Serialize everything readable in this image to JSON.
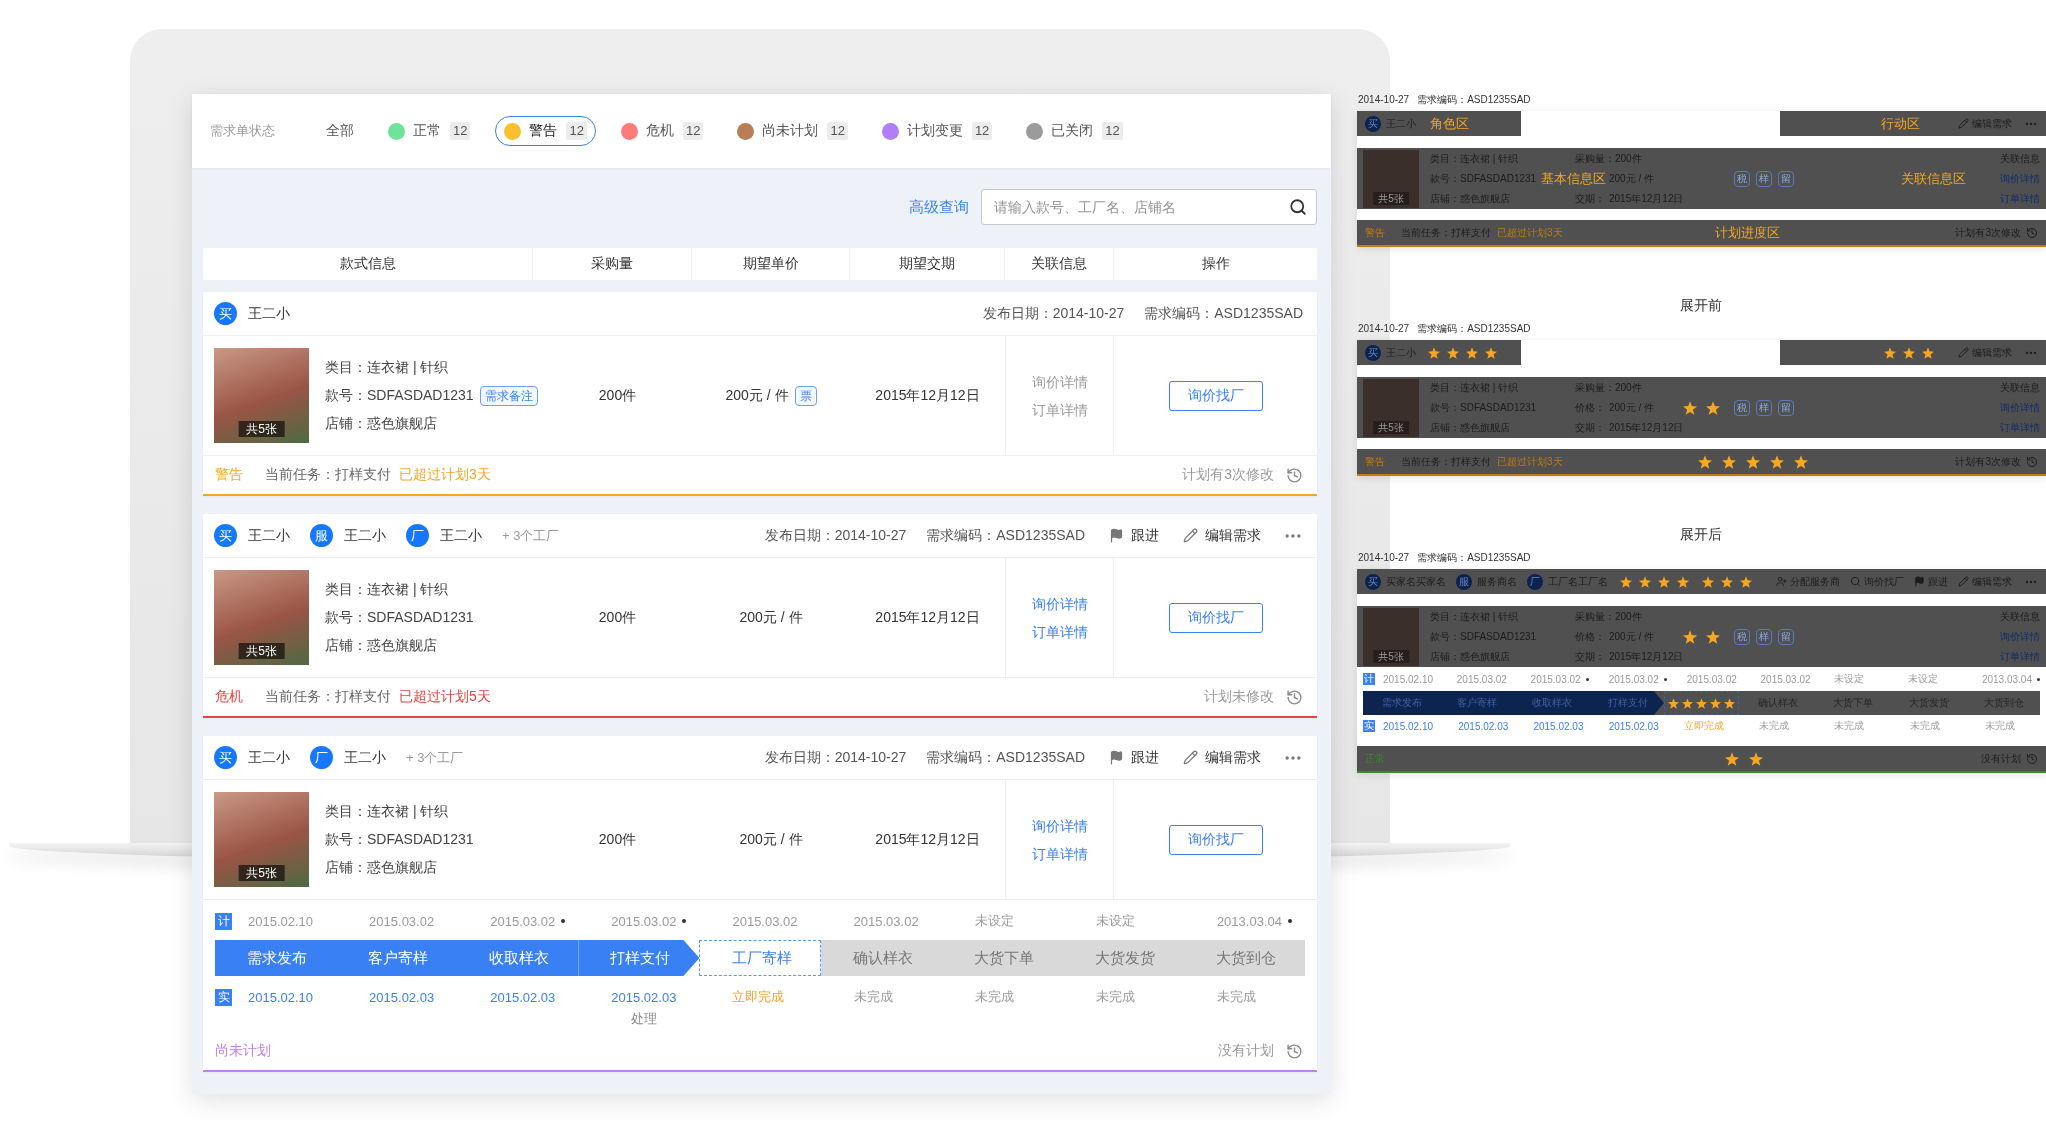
{
  "status_filter": {
    "label": "需求单状态",
    "items": [
      {
        "label": "全部",
        "selected": false
      },
      {
        "label": "正常",
        "count": "12",
        "color": "#6fe29c",
        "selected": false
      },
      {
        "label": "警告",
        "count": "12",
        "color": "#fbc02d",
        "selected": true
      },
      {
        "label": "危机",
        "count": "12",
        "color": "#ff7b7b",
        "selected": false
      },
      {
        "label": "尚未计划",
        "count": "12",
        "color": "#b97e57",
        "selected": false
      },
      {
        "label": "计划变更",
        "count": "12",
        "color": "#b07ef8",
        "selected": false
      },
      {
        "label": "已关闭",
        "count": "12",
        "color": "#9b9b9b",
        "selected": false
      }
    ]
  },
  "search": {
    "advanced_link": "高级查询",
    "placeholder": "请输入款号、工厂名、店铺名"
  },
  "table": {
    "columns": [
      "款式信息",
      "采购量",
      "期望单价",
      "期望交期",
      "关联信息",
      "操作"
    ]
  },
  "orders": [
    {
      "roles": [
        {
          "badge": "买",
          "name": "王二小"
        }
      ],
      "publish_date": "发布日期：2014-10-27",
      "code": "需求编码：ASD1235SAD",
      "photo_count": "共5张",
      "category": "类目：连衣裙 | 针织",
      "style_no": "款号：SDFASDAD1231",
      "note_tag": "需求备注",
      "shop": "店铺：惑色旗舰店",
      "quantity": "200件",
      "price": "200元 / 件",
      "invoice_tag": "票",
      "delivery": "2015年12月12日",
      "links": [
        {
          "label": "询价详情",
          "disabled": true
        },
        {
          "label": "订单详情",
          "disabled": true
        }
      ],
      "button": "询价找厂",
      "status": {
        "label": "警告",
        "color": "#f5a623"
      },
      "task": "当前任务：打样支付",
      "overdue": "已超过计划3天",
      "plan_note": "计划有3次修改"
    },
    {
      "roles": [
        {
          "badge": "买",
          "name": "王二小"
        },
        {
          "badge": "服",
          "name": "王二小"
        },
        {
          "badge": "厂",
          "name": "王二小"
        }
      ],
      "more_factories": "+ 3个工厂",
      "publish_date": "发布日期：2014-10-27",
      "code": "需求编码：ASD1235SAD",
      "actions": [
        {
          "kind": "follow",
          "label": "跟进"
        },
        {
          "kind": "edit",
          "label": "编辑需求"
        },
        {
          "kind": "more"
        }
      ],
      "photo_count": "共5张",
      "category": "类目：连衣裙 | 针织",
      "style_no": "款号：SDFASDAD1231",
      "shop": "店铺：惑色旗舰店",
      "quantity": "200件",
      "price": "200元 / 件",
      "delivery": "2015年12月12日",
      "links": [
        {
          "label": "询价详情",
          "disabled": false
        },
        {
          "label": "订单详情",
          "disabled": false
        }
      ],
      "button": "询价找厂",
      "status": {
        "label": "危机",
        "color": "#e8413e"
      },
      "task": "当前任务：打样支付",
      "overdue": "已超过计划5天",
      "plan_note": "计划未修改"
    },
    {
      "roles": [
        {
          "badge": "买",
          "name": "王二小"
        },
        {
          "badge": "厂",
          "name": "王二小"
        }
      ],
      "more_factories": "+ 3个工厂",
      "publish_date": "发布日期：2014-10-27",
      "code": "需求编码：ASD1235SAD",
      "actions": [
        {
          "kind": "follow",
          "label": "跟进"
        },
        {
          "kind": "edit",
          "label": "编辑需求"
        },
        {
          "kind": "more"
        }
      ],
      "photo_count": "共5张",
      "category": "类目：连衣裙 | 针织",
      "style_no": "款号：SDFASDAD1231",
      "shop": "店铺：惑色旗舰店",
      "quantity": "200件",
      "price": "200元 / 件",
      "delivery": "2015年12月12日",
      "links": [
        {
          "label": "询价详情",
          "disabled": false
        },
        {
          "label": "订单详情",
          "disabled": false
        }
      ],
      "button": "询价找厂",
      "timeline": {
        "plan_tag": "计",
        "plan": [
          {
            "date": "2015.02.10",
            "flagged": false
          },
          {
            "date": "2015.03.02",
            "flagged": false
          },
          {
            "date": "2015.03.02",
            "flagged": true
          },
          {
            "date": "2015.03.02",
            "flagged": true
          },
          {
            "date": "2015.03.02",
            "flagged": false
          },
          {
            "date": "2015.03.02",
            "flagged": false
          },
          {
            "date": "未设定",
            "flagged": false
          },
          {
            "date": "未设定",
            "flagged": false
          },
          {
            "date": "2013.03.04",
            "flagged": true
          }
        ],
        "steps": [
          {
            "label": "需求发布",
            "kind": "done"
          },
          {
            "label": "客户寄样",
            "kind": "done"
          },
          {
            "label": "收取样衣",
            "kind": "done"
          },
          {
            "label": "打样支付",
            "kind": "done"
          },
          {
            "label": "工厂寄样",
            "kind": "current"
          },
          {
            "label": "确认样衣",
            "kind": "todo"
          },
          {
            "label": "大货下单",
            "kind": "todo"
          },
          {
            "label": "大货发货",
            "kind": "todo"
          },
          {
            "label": "大货到仓",
            "kind": "todo"
          }
        ],
        "actual_tag": "实",
        "actual": [
          {
            "text": "2015.02.10",
            "kind": "done"
          },
          {
            "text": "2015.02.03",
            "kind": "done"
          },
          {
            "text": "2015.02.03",
            "kind": "done"
          },
          {
            "text": "2015.02.03",
            "kind": "done",
            "note": "处理"
          },
          {
            "text": "立即完成",
            "kind": "action"
          },
          {
            "text": "未完成",
            "kind": "pending"
          },
          {
            "text": "未完成",
            "kind": "pending"
          },
          {
            "text": "未完成",
            "kind": "pending"
          },
          {
            "text": "未完成",
            "kind": "pending"
          }
        ]
      },
      "status": {
        "label": "尚未计划",
        "color": "#c27ef3"
      },
      "plan_note": "没有计划"
    }
  ],
  "wireframes": [
    {
      "date": "2014-10-27",
      "code": "需求编码：ASD1235SAD",
      "roles": [
        {
          "badge": "买",
          "name": "王二小"
        }
      ],
      "role_zone": "角色区",
      "action_zone": "行动区",
      "actions": [
        {
          "kind": "edit",
          "label": "编辑需求"
        },
        {
          "kind": "more"
        }
      ],
      "photo_count": "共5张",
      "category": "类目：连衣裙 | 针织",
      "style_no": "款号：SDFASDAD1231",
      "shop": "店铺：惑色旗舰店",
      "quantity": "采购量：200件",
      "price": "200元 / 件",
      "delivery_label": "交期：",
      "delivery": "2015年12月12日",
      "info_zone": "基本信息区",
      "tags": [
        "税",
        "样",
        "留"
      ],
      "related_zone": "关联信息区",
      "related_title": "关联信息",
      "links": [
        "询价详情",
        "订单详情"
      ],
      "status": {
        "label": "警告",
        "color": "#c27a14"
      },
      "task": "当前任务：打样支付",
      "overdue": "已超过计划3天",
      "progress_zone": "计划进度区",
      "plan_note": "计划有3次修改"
    },
    {
      "caption": "展开前",
      "date": "2014-10-27",
      "code": "需求编码：ASD1235SAD",
      "roles": [
        {
          "badge": "买",
          "name": "王二小"
        }
      ],
      "role_rating": {
        "stars": 4
      },
      "action_rating": {
        "stars": 3
      },
      "actions": [
        {
          "kind": "edit",
          "label": "编辑需求"
        },
        {
          "kind": "more"
        }
      ],
      "photo_count": "共5张",
      "category": "类目：连衣裙 | 针织",
      "style_no": "款号：SDFASDAD1231",
      "shop": "店铺：惑色旗舰店",
      "quantity": "采购量：200件",
      "price_label": "价格：",
      "price": "200元 / 件",
      "delivery_label": "交期：",
      "delivery": "2015年12月12日",
      "body_rating": {
        "stars": 2
      },
      "tags": [
        "税",
        "样",
        "留"
      ],
      "related_title": "关联信息",
      "links": [
        "询价详情",
        "订单详情"
      ],
      "status": {
        "label": "警告",
        "color": "#c27a14"
      },
      "task": "当前任务：打样支付",
      "overdue": "已超过计划3天",
      "footer_rating": {
        "stars": 5
      },
      "plan_note": "计划有3次修改"
    },
    {
      "caption": "展开后",
      "date": "2014-10-27",
      "code": "需求编码：ASD1235SAD",
      "roles": [
        {
          "badge": "买",
          "name": "买家名买家名"
        },
        {
          "badge": "服",
          "name": "服务商名"
        },
        {
          "badge": "厂",
          "name": "工厂名工厂名"
        }
      ],
      "role_rating": {
        "stars": 4
      },
      "action_rating": {
        "stars": 3
      },
      "actions": [
        {
          "kind": "assign",
          "label": "分配服务商"
        },
        {
          "kind": "search",
          "label": "询价找厂"
        },
        {
          "kind": "follow",
          "label": "跟进"
        },
        {
          "kind": "edit",
          "label": "编辑需求"
        },
        {
          "kind": "more"
        }
      ],
      "photo_count": "共5张",
      "category": "类目：连衣裙 | 针织",
      "style_no": "款号：SDFASDAD1231",
      "shop": "店铺：惑色旗舰店",
      "quantity": "采购量：200件",
      "price_label": "价格：",
      "price": "200元 / 件",
      "delivery_label": "交期：",
      "delivery": "2015年12月12日",
      "body_rating": {
        "stars": 2
      },
      "tags": [
        "税",
        "样",
        "留"
      ],
      "related_title": "关联信息",
      "links": [
        "询价详情",
        "订单详情"
      ],
      "timeline": {
        "plan_tag": "计",
        "plan": [
          {
            "date": "2015.02.10",
            "flagged": false
          },
          {
            "date": "2015.03.02",
            "flagged": false
          },
          {
            "date": "2015.03.02",
            "flagged": true
          },
          {
            "date": "2015.03.02",
            "flagged": true
          },
          {
            "date": "2015.03.02",
            "flagged": false
          },
          {
            "date": "2015.03.02",
            "flagged": false
          },
          {
            "date": "未设定",
            "flagged": false
          },
          {
            "date": "未设定",
            "flagged": false
          },
          {
            "date": "2013.03.04",
            "flagged": true
          }
        ],
        "steps": [
          {
            "label": "需求发布",
            "kind": "done"
          },
          {
            "label": "客户寄样",
            "kind": "done"
          },
          {
            "label": "收取样衣",
            "kind": "done"
          },
          {
            "label": "打样支付",
            "kind": "done"
          },
          {
            "kind": "current"
          },
          {
            "label": "确认样衣",
            "kind": "todo"
          },
          {
            "label": "大货下单",
            "kind": "todo"
          },
          {
            "label": "大货发货",
            "kind": "todo"
          },
          {
            "label": "大货到仓",
            "kind": "todo"
          }
        ],
        "stars": 5,
        "actual_tag": "实",
        "actual": [
          {
            "text": "2015.02.10",
            "kind": "done"
          },
          {
            "text": "2015.02.03",
            "kind": "done"
          },
          {
            "text": "2015.02.03",
            "kind": "done"
          },
          {
            "text": "2015.02.03",
            "kind": "done"
          },
          {
            "text": "立即完成",
            "kind": "action"
          },
          {
            "text": "未完成",
            "kind": "pending"
          },
          {
            "text": "未完成",
            "kind": "pending"
          },
          {
            "text": "未完成",
            "kind": "pending"
          },
          {
            "text": "未完成",
            "kind": "pending"
          }
        ]
      },
      "status": {
        "label": "正常",
        "color": "#3a8a26"
      },
      "footer_rating": {
        "stars": 2
      },
      "plan_note": "没有计划"
    }
  ]
}
